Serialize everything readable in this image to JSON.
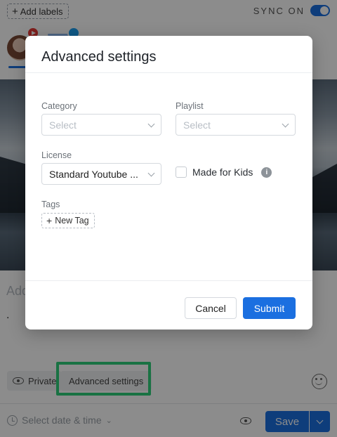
{
  "composer": {
    "add_labels": "Add labels",
    "sync_label": "SYNC ON",
    "caption_placeholder": "Add",
    "caption_text": ".",
    "private_label": "Private",
    "advanced_settings_label": "Advanced settings",
    "date_placeholder": "Select date & time",
    "save_label": "Save"
  },
  "modal": {
    "title": "Advanced settings",
    "category": {
      "label": "Category",
      "placeholder": "Select"
    },
    "playlist": {
      "label": "Playlist",
      "placeholder": "Select"
    },
    "license": {
      "label": "License",
      "value": "Standard Youtube ..."
    },
    "made_for_kids": {
      "label": "Made for Kids",
      "checked": false
    },
    "tags": {
      "label": "Tags",
      "new_tag": "New Tag"
    },
    "cancel_label": "Cancel",
    "submit_label": "Submit"
  },
  "colors": {
    "primary": "#1b6fe0",
    "highlight": "#2ed07a",
    "youtube": "#e53935",
    "twitter": "#1da1f2"
  },
  "icons": [
    "plus-icon",
    "youtube-icon",
    "twitter-icon",
    "eye-icon",
    "emoji-icon",
    "clock-icon",
    "chevron-down-icon",
    "info-icon"
  ]
}
